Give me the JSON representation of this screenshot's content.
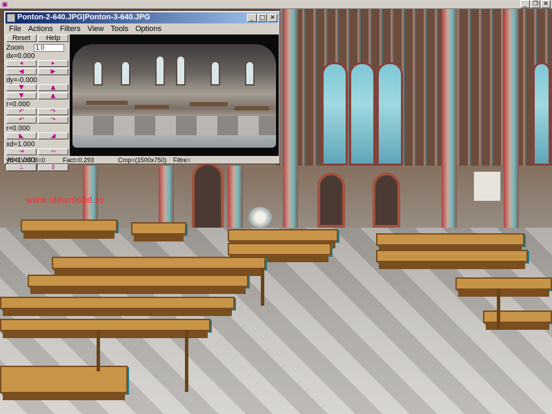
{
  "app": {
    "frame_buttons": [
      "_",
      "❐",
      "✕"
    ]
  },
  "window": {
    "title": "Ponton-2-640.JPG|Ponton-3-640.JPG",
    "buttons": [
      "_",
      "□",
      "✕"
    ]
  },
  "menu": [
    "File",
    "Actions",
    "Filters",
    "View",
    "Tools",
    "Options"
  ],
  "controls": {
    "reset_label": "Reset",
    "help_label": "Help",
    "zoom_label": "Zoom",
    "zoom_value": "1.0",
    "dx_label": "dx=0.000",
    "dy_label": "dy=-0.000",
    "r_label": "r=0.000",
    "r2_label": "r=0.000",
    "xd_label": "xd=1.000",
    "yd_label": "yd=1.000"
  },
  "status": {
    "rgb": "R=0 V=0 B=0",
    "fact": "Fact=0.293",
    "crop": "Crop=(1500x750)",
    "filtre": "Filtre="
  },
  "background": {
    "watermark": "www.idownload.ro"
  },
  "colors": {
    "titlebar_start": "#0a246a",
    "titlebar_end": "#a6caf0",
    "arrow_color": "#c2008f",
    "watermark": "#ff2b2b"
  }
}
